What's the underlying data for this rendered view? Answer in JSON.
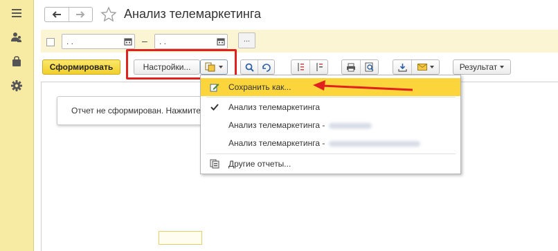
{
  "sidebar": {
    "items": [
      {
        "icon": "menu-icon"
      },
      {
        "icon": "users-icon"
      },
      {
        "icon": "bag-icon"
      },
      {
        "icon": "gear-icon"
      }
    ]
  },
  "header": {
    "title": "Анализ телемаркетинга",
    "back_icon": "arrow-left-icon",
    "forward_icon": "arrow-right-icon",
    "favorite_icon": "star-icon"
  },
  "period": {
    "start_value": ". .",
    "end_value": ". .",
    "separator": "–",
    "more_label": "..."
  },
  "toolbar": {
    "generate_label": "Сформировать",
    "settings_label": "Настройки...",
    "result_label": "Результат"
  },
  "report": {
    "notice_text": "Отчет не сформирован. Нажмите"
  },
  "variants_menu": {
    "save_as_label": "Сохранить как...",
    "items": [
      {
        "label": "Анализ телемаркетинга",
        "checked": true
      },
      {
        "label": "Анализ телемаркетинга -",
        "checked": false
      },
      {
        "label": "Анализ телемаркетинга -",
        "checked": false
      }
    ],
    "other_reports_label": "Другие отчеты..."
  },
  "colors": {
    "sidebar_bg": "#f7eaa3",
    "accent_yellow": "#fbd53b",
    "primary_button": "#f1cf2b",
    "highlight_red": "#e0211d"
  }
}
